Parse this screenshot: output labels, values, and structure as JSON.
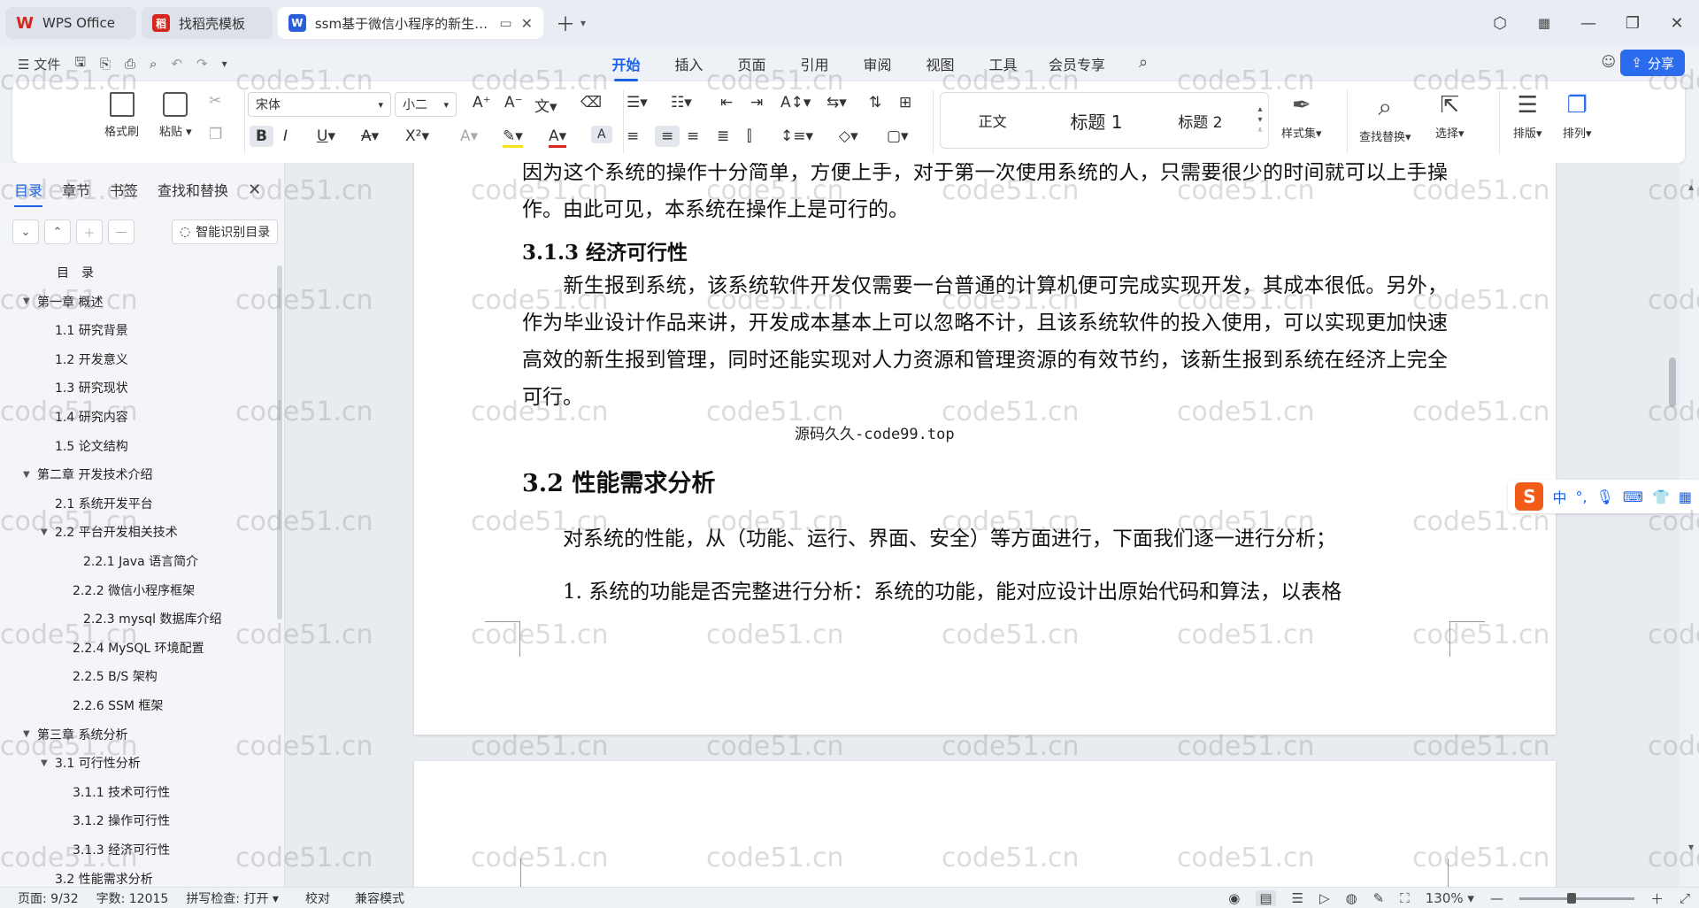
{
  "titlebar": {
    "tabs": [
      {
        "label": "WPS Office",
        "icon": "wps-logo-icon"
      },
      {
        "label": "找稻壳模板",
        "icon": "docer-icon"
      },
      {
        "label": "ssm基于微信小程序的新生报到",
        "icon": "word-doc-icon"
      }
    ]
  },
  "menu": {
    "file_label": "文件",
    "items": [
      "开始",
      "插入",
      "页面",
      "引用",
      "审阅",
      "视图",
      "工具",
      "会员专享"
    ],
    "active_index": 0,
    "share_label": "分享"
  },
  "ribbon": {
    "format_painter": "格式刷",
    "paste": "粘贴",
    "font_name": "宋体",
    "font_size": "小二",
    "styles": [
      "正文",
      "标题 1",
      "标题 2"
    ],
    "style_set": "样式集",
    "find_replace": "查找替换",
    "select": "选择",
    "layout": "排版",
    "arrange": "排列",
    "bold": "B",
    "italic": "I",
    "underline": "U",
    "strike": "A",
    "superscript": "X²"
  },
  "nav": {
    "tabs": [
      "目录",
      "章节",
      "书签",
      "查找和替换"
    ],
    "smart_toc": "智能识别目录",
    "toc": [
      {
        "label": "目　录",
        "level": 0,
        "tri": false
      },
      {
        "label": "第一章  概述",
        "level": 0,
        "tri": true
      },
      {
        "label": "1.1  研究背景",
        "level": 1,
        "tri": false
      },
      {
        "label": "1.2  开发意义",
        "level": 1,
        "tri": false
      },
      {
        "label": "1.3  研究现状",
        "level": 1,
        "tri": false
      },
      {
        "label": "1.4  研究内容",
        "level": 1,
        "tri": false
      },
      {
        "label": "1.5  论文结构",
        "level": 1,
        "tri": false
      },
      {
        "label": "第二章  开发技术介绍",
        "level": 0,
        "tri": true
      },
      {
        "label": "2.1  系统开发平台",
        "level": 1,
        "tri": false
      },
      {
        "label": "2.2  平台开发相关技术",
        "level": 1,
        "tri": true
      },
      {
        "label": "2.2.1   Java 语言简介",
        "level": 3,
        "tri": false
      },
      {
        "label": "2.2.2   微信小程序框架",
        "level": 2,
        "tri": false
      },
      {
        "label": "2.2.3   mysql 数据库介绍",
        "level": 3,
        "tri": false
      },
      {
        "label": "2.2.4   MySQL 环境配置",
        "level": 2,
        "tri": false
      },
      {
        "label": "2.2.5   B/S 架构",
        "level": 2,
        "tri": false
      },
      {
        "label": "2.2.6   SSM 框架",
        "level": 2,
        "tri": false
      },
      {
        "label": "第三章  系统分析",
        "level": 0,
        "tri": true
      },
      {
        "label": "3.1  可行性分析",
        "level": 1,
        "tri": true
      },
      {
        "label": "3.1.1  技术可行性",
        "level": 2,
        "tri": false
      },
      {
        "label": "3.1.2  操作可行性",
        "level": 2,
        "tri": false
      },
      {
        "label": "3.1.3  经济可行性",
        "level": 2,
        "tri": false
      },
      {
        "label": "3.2 性能需求分析",
        "level": 1,
        "tri": false
      }
    ]
  },
  "document": {
    "p1": "因为这个系统的操作十分简单，方便上手，对于第一次使用系统的人，只需要很少的时间就可以上手操作。由此可见，本系统在操作上是可行的。",
    "h_313": "3.1.3  经济可行性",
    "p2": "　　新生报到系统，该系统软件开发仅需要一台普通的计算机便可完成实现开发，其成本很低。另外，作为毕业设计作品来讲，开发成本基本上可以忽略不计，且该系统软件的投入使用，可以实现更加快速高效的新生报到管理，同时还能实现对人力资源和管理资源的有效节约，该新生报到系统在经济上完全可行。",
    "source_mark": "源码久久-code99.top",
    "h_32": "3.2 性能需求分析",
    "p3": "　　对系统的性能，从（功能、运行、界面、安全）等方面进行，下面我们逐一进行分析；",
    "p4": "　　1.  系统的功能是否完整进行分析：系统的功能，能对应设计出原始代码和算法，以表格"
  },
  "ime": {
    "label": "中"
  },
  "watermark": "code51.cn",
  "status": {
    "page": "页面: 9/32",
    "words": "字数: 12015",
    "spell": "拼写检查: 打开",
    "proof": "校对",
    "compat": "兼容模式",
    "zoom": "130%",
    "zoom_fraction": 0.45
  },
  "colors": {
    "accent": "#1b62e8",
    "wps_red": "#d7261e",
    "sogou_orange": "#f25c19"
  }
}
